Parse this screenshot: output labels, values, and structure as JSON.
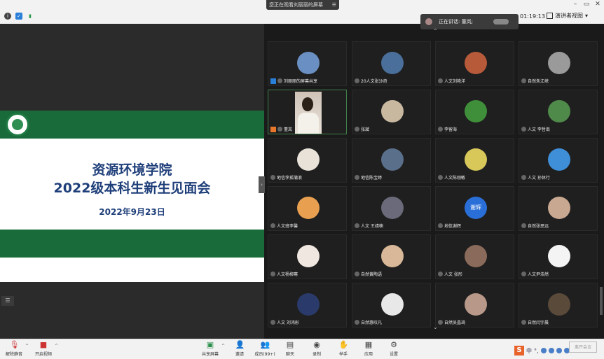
{
  "top": {
    "notice": "您正在观看刘丽丽的屏幕",
    "timer": "01:19:13",
    "speaker_view": "演讲者视图",
    "speaking": "正在讲话: 董岚;"
  },
  "slide": {
    "title1": "资源环境学院",
    "title2": "2022级本科生新生见面会",
    "date": "2022年9月23日"
  },
  "participants": [
    {
      "name": "刘丽丽的屏幕共享",
      "color": "#6a8fc2"
    },
    {
      "name": "20人文张沙奇",
      "color": "#4a6f9a"
    },
    {
      "name": "人文刘艳洋",
      "color": "#b75a3a"
    },
    {
      "name": "自然朱江峡",
      "color": "#9a9a9a"
    },
    {
      "name": "董岚",
      "color": "#d9cfc5"
    },
    {
      "name": "张斌",
      "color": "#c8b8a0"
    },
    {
      "name": "李留海",
      "color": "#3f8f3a"
    },
    {
      "name": "人文 李哲南",
      "color": "#4f8a4a"
    },
    {
      "name": "地信李孤蒲浪",
      "color": "#e8e2d8"
    },
    {
      "name": "地信陈宝婷",
      "color": "#5a6f8a"
    },
    {
      "name": "人文陈刚敏",
      "color": "#d8c85a"
    },
    {
      "name": "人文 孙休行",
      "color": "#3f8fd8"
    },
    {
      "name": "人文班李馨",
      "color": "#e8a050"
    },
    {
      "name": "人文 王靖楠",
      "color": "#6a6a7a"
    },
    {
      "name": "地信谢辉",
      "color": "#2a6fd8"
    },
    {
      "name": "自然张思远",
      "color": "#c8a890"
    },
    {
      "name": "人文杨柳骞",
      "color": "#f0e8e0"
    },
    {
      "name": "自然黄陶语",
      "color": "#d8b898"
    },
    {
      "name": "人文 张彤",
      "color": "#8a6a5a"
    },
    {
      "name": "人文尹浩然",
      "color": "#f4f4f4"
    },
    {
      "name": "人文 刘鸿彤",
      "color": "#2a3a6a"
    },
    {
      "name": "自然惠叹凡",
      "color": "#e8e8e8"
    },
    {
      "name": "自然吴晶琦",
      "color": "#b89888"
    },
    {
      "name": "自然闫宇晨",
      "color": "#5a4a3a"
    }
  ],
  "avatar_texts": {
    "xiehui": "谢辉"
  },
  "toolbar": {
    "mute": "解除静音",
    "video": "开启视频",
    "share": "共享屏幕",
    "invite": "邀请",
    "members": "成员(99+)",
    "chat": "聊天",
    "record": "录制",
    "raise": "举手",
    "apps": "应用",
    "settings": "设置",
    "end": "离开会议"
  }
}
